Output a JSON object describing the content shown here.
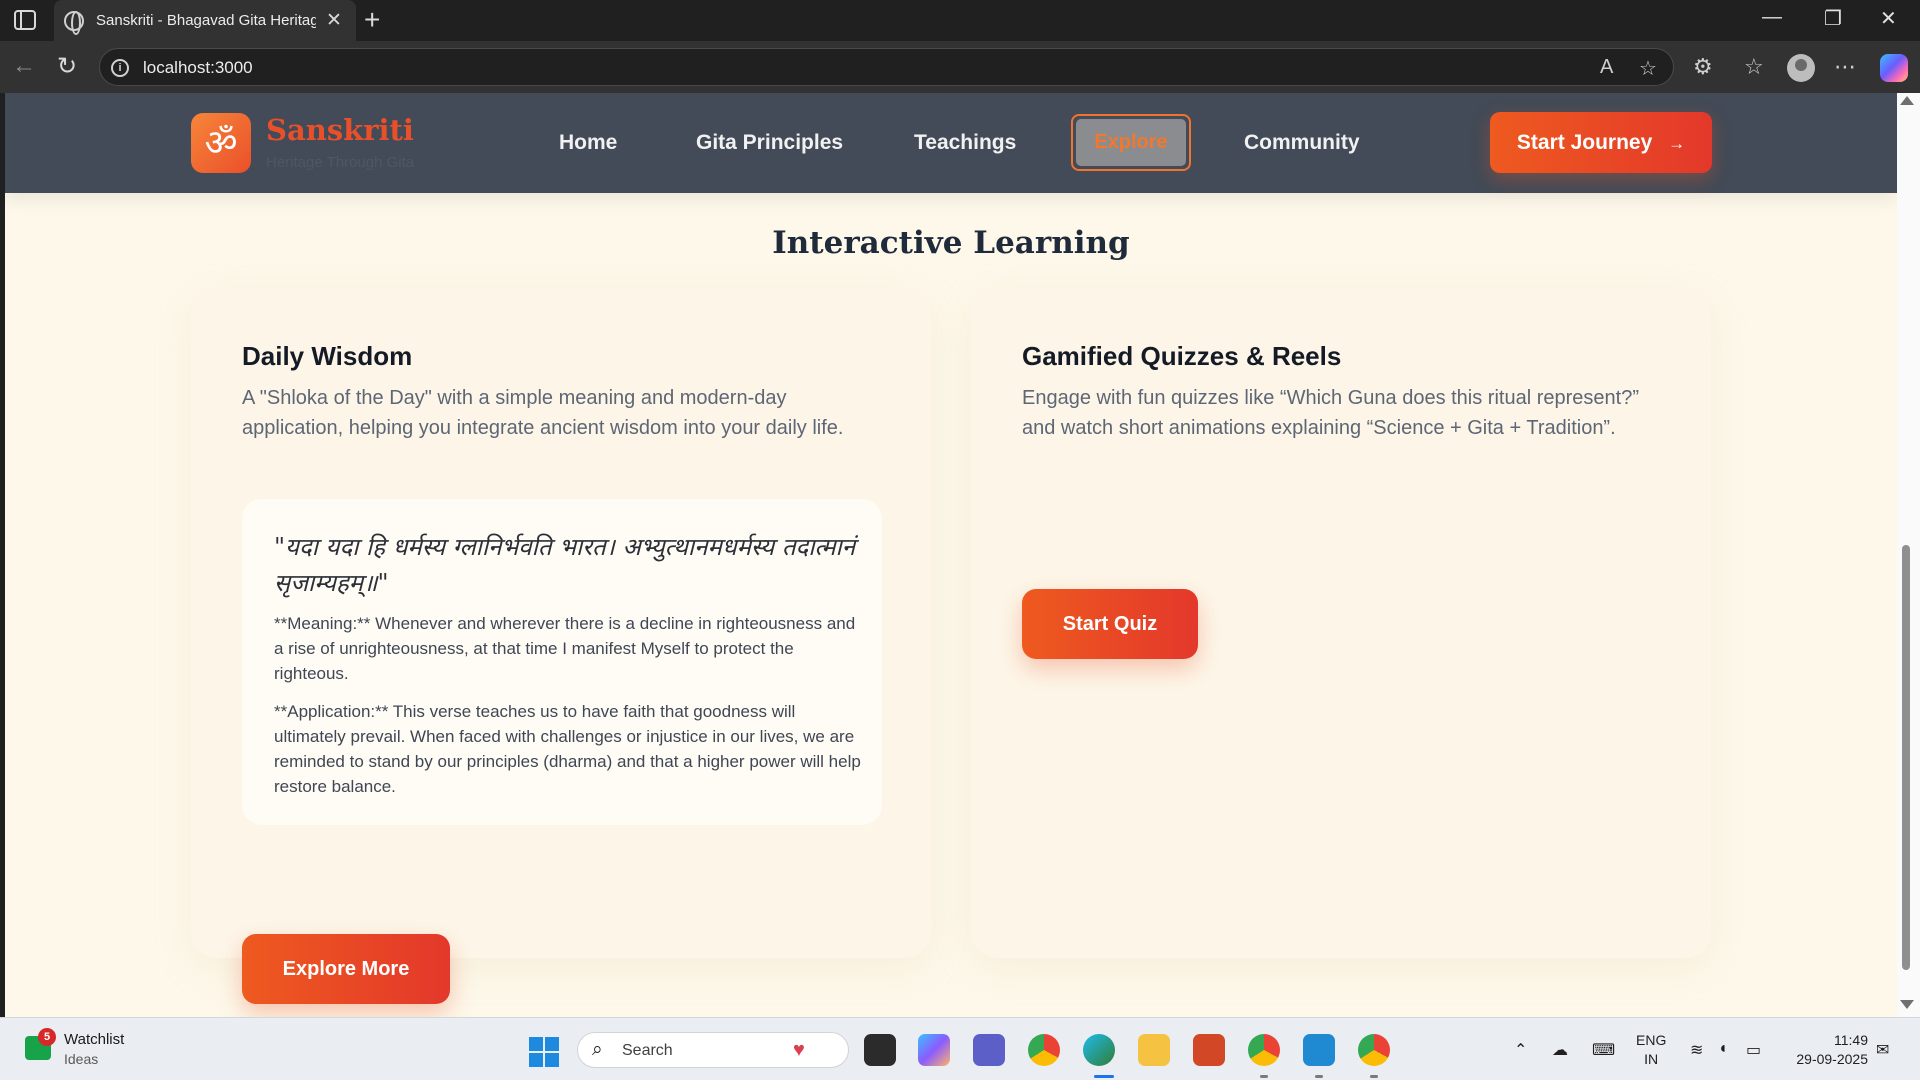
{
  "browser": {
    "tab_title": "Sanskriti - Bhagavad Gita Heritage",
    "url": "localhost:3000"
  },
  "site": {
    "brand_name": "Sanskriti",
    "tagline": "Heritage Through Gita",
    "logo_glyph": "ॐ",
    "nav": [
      {
        "label": "Home"
      },
      {
        "label": "Gita Principles"
      },
      {
        "label": "Teachings"
      },
      {
        "label": "Explore",
        "active": true
      },
      {
        "label": "Community"
      }
    ],
    "cta_label": "Start Journey",
    "cta_icon": "arrow-right-icon"
  },
  "section": {
    "title": "Interactive Learning"
  },
  "daily_wisdom": {
    "heading": "Daily Wisdom",
    "description": "A \"Shloka of the Day\" with a simple meaning and modern-day application, helping you integrate ancient wisdom into your daily life.",
    "shloka": "\"यदा यदा हि धर्मस्य ग्लानिर्भवति भारत। अभ्युत्थानमधर्मस्य तदात्मानं सृजाम्यहम्॥\"",
    "meaning": "**Meaning:** Whenever and wherever there is a decline in righteousness and a rise of unrighteousness, at that time I manifest Myself to protect the righteous.",
    "application": "**Application:** This verse teaches us to have faith that goodness will ultimately prevail. When faced with challenges or injustice in our lives, we are reminded to stand by our principles (dharma) and that a higher power will help restore balance.",
    "button_label": "Explore More"
  },
  "quizzes": {
    "heading": "Gamified Quizzes & Reels",
    "description": "Engage with fun quizzes like “Which Guna does this ritual represent?” and watch short animations explaining “Science + Gita + Tradition”.",
    "button_label": "Start Quiz"
  },
  "taskbar": {
    "widget_title": "Watchlist",
    "widget_subtitle": "Ideas",
    "widget_badge": "5",
    "search_placeholder": "Search",
    "language_line1": "ENG",
    "language_line2": "IN",
    "time": "11:49",
    "date": "29-09-2025"
  },
  "colors": {
    "accent": "#ea4f2a",
    "header_bg": "#424b57",
    "page_bg": "#fdf8ea"
  }
}
